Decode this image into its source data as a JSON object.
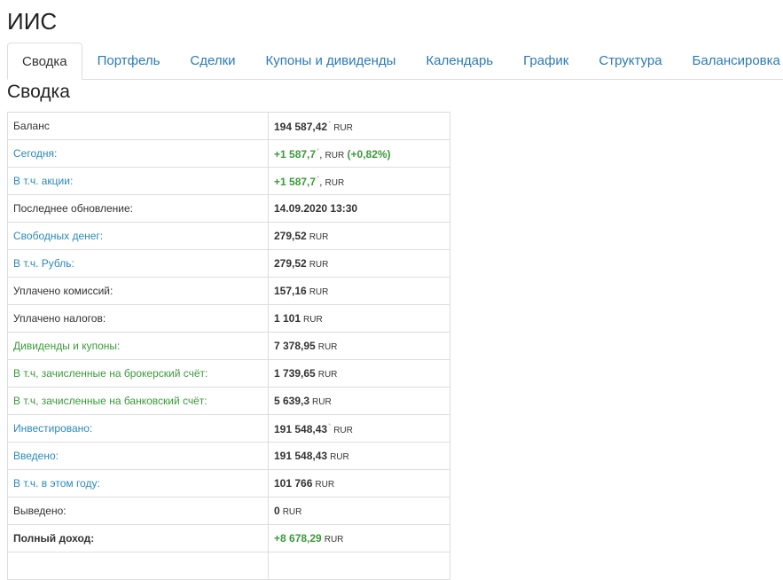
{
  "page": {
    "title": "ИИС"
  },
  "tabs": [
    "Сводка",
    "Портфель",
    "Сделки",
    "Купоны и дивиденды",
    "Календарь",
    "График",
    "Структура",
    "Балансировка"
  ],
  "section_title": "Сводка",
  "currency": "RUR",
  "tick_mark": "*",
  "rows": {
    "balance": {
      "label": "Баланс",
      "value": "194 587,42"
    },
    "today": {
      "label": "Сегодня:",
      "value": "+1 587,7",
      "pct": "(+0,82%)"
    },
    "stocks": {
      "label": "В т.ч. акции:",
      "value": "+1 587,7"
    },
    "updated": {
      "label": "Последнее обновление:",
      "value": "14.09.2020 13:30"
    },
    "free_cash": {
      "label": "Свободных денег:",
      "value": "279,52"
    },
    "rub": {
      "label": "В т.ч. Рубль:",
      "value": "279,52"
    },
    "commission": {
      "label": "Уплачено комиссий:",
      "value": "157,16"
    },
    "taxes": {
      "label": "Уплачено налогов:",
      "value": "1 101"
    },
    "dividends": {
      "label": "Дивиденды и купоны:",
      "value": "7 378,95"
    },
    "broker": {
      "label": "В т.ч, зачисленные на брокерский счёт:",
      "value": "1 739,65"
    },
    "bank": {
      "label": "В т.ч, зачисленные на банковский счёт:",
      "value": "5 639,3"
    },
    "invested": {
      "label": "Инвестировано:",
      "value": "191 548,43"
    },
    "deposited": {
      "label": "Введено:",
      "value": "191 548,43"
    },
    "this_year": {
      "label": "В т.ч. в этом году:",
      "value": "101 766"
    },
    "withdrawn": {
      "label": "Выведено:",
      "value": "0"
    },
    "total_income": {
      "label": "Полный доход:",
      "value": "+8 678,29"
    }
  },
  "colors": {
    "link": "#2a7ab8",
    "label_blue": "#2a8ab8",
    "positive": "#3a9a3a",
    "border": "#dddddd"
  }
}
